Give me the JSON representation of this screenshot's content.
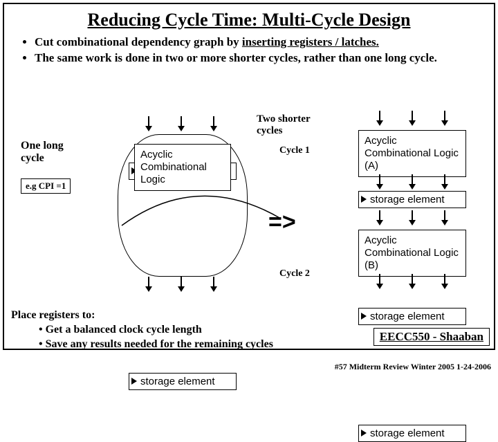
{
  "title": "Reducing Cycle Time:  Multi-Cycle Design",
  "bullets": [
    {
      "pre": "Cut combinational dependency graph by ",
      "u": "inserting registers / latches."
    },
    {
      "pre": "The same work is done in two or more shorter cycles, rather than one long cycle.",
      "u": ""
    }
  ],
  "labels": {
    "storage": "storage element",
    "acyclic": "Acyclic Combinational Logic",
    "acyclicA": "Acyclic Combinational Logic (A)",
    "acyclicB": "Acyclic Combinational Logic (B)",
    "oneLong": "One long cycle",
    "cpi": "e.g CPI =1",
    "twoShorter": "Two shorter cycles",
    "cycle1": "Cycle 1",
    "cycle2": "Cycle 2",
    "arrow": "=>"
  },
  "bottom": {
    "l1": "Place registers to:",
    "l2": "• Get a balanced clock cycle length",
    "l3": "• Save any results needed for the remaining cycles"
  },
  "classBox": "EECC550 - Shaaban",
  "footer": "#57   Midterm Review   Winter 2005  1-24-2006"
}
